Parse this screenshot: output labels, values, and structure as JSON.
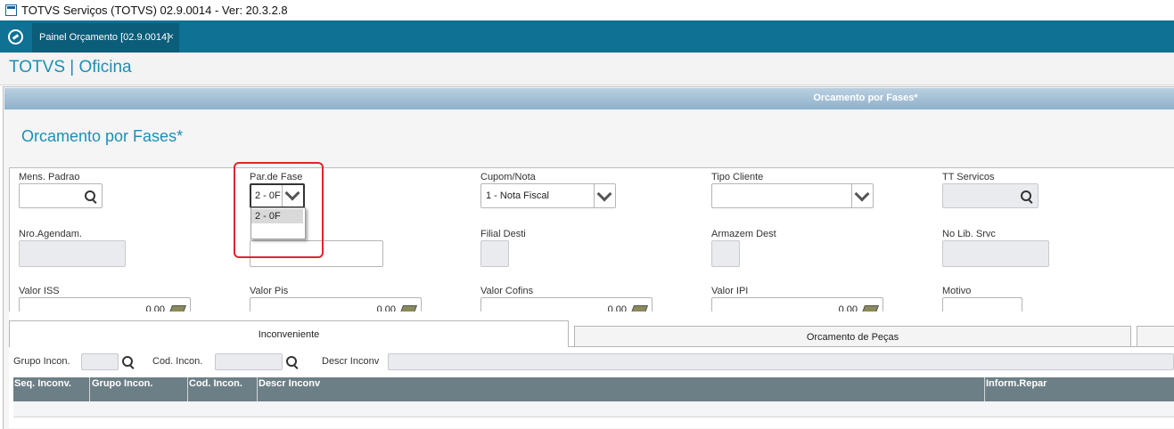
{
  "window": {
    "title": "TOTVS Serviços (TOTVS) 02.9.0014 - Ver: 20.3.2.8"
  },
  "tabbar": {
    "tab_label": "Painel Orçamento [02.9.0014]",
    "tab_close": "×"
  },
  "header": {
    "brand": "TOTVS | Oficina"
  },
  "panel": {
    "bar_title": "Orcamento por Fases*",
    "form_title": "Orcamento por Fases*"
  },
  "fields": {
    "mens_padrao": {
      "label": "Mens. Padrao",
      "value": ""
    },
    "par_fase": {
      "label": "Par.de Fase",
      "value": "2 - 0F",
      "options": [
        "2 - 0F"
      ]
    },
    "cupom_nota": {
      "label": "Cupom/Nota",
      "value": "1 - Nota Fiscal"
    },
    "tipo_cliente": {
      "label": "Tipo Cliente",
      "value": ""
    },
    "tt_servicos": {
      "label": "TT Servicos",
      "value": ""
    },
    "nro_agendam": {
      "label": "Nro.Agendam.",
      "value": ""
    },
    "filial_desti": {
      "label": "Filial Desti",
      "value": ""
    },
    "armazem_dest": {
      "label": "Armazem Dest",
      "value": ""
    },
    "no_lib_srvc": {
      "label": "No Lib. Srvc",
      "value": ""
    },
    "valor_iss": {
      "label": "Valor ISS",
      "value": "0,00"
    },
    "valor_pis": {
      "label": "Valor Pis",
      "value": "0,00"
    },
    "valor_cofins": {
      "label": "Valor Cofins",
      "value": "0,00"
    },
    "valor_ipi": {
      "label": "Valor IPI",
      "value": "0,00"
    },
    "motivo": {
      "label": "Motivo",
      "value": ""
    }
  },
  "tabs": [
    {
      "label": "Inconveniente"
    },
    {
      "label": "Orcamento de Peças"
    }
  ],
  "filters": {
    "grupo_incon": "Grupo Incon.",
    "cod_incon": "Cod. Incon.",
    "descr_inconv": "Descr Inconv"
  },
  "grid": {
    "columns": [
      "Seq. Inconv.",
      "Grupo Incon.",
      "Cod. Incon.",
      "Descr Inconv",
      "Inform.Repar"
    ]
  },
  "colors": {
    "brand_teal": "#0f7194",
    "accent_blue": "#1d8fb3",
    "highlight_red": "#e0242c",
    "grid_header": "#6d7f86"
  }
}
